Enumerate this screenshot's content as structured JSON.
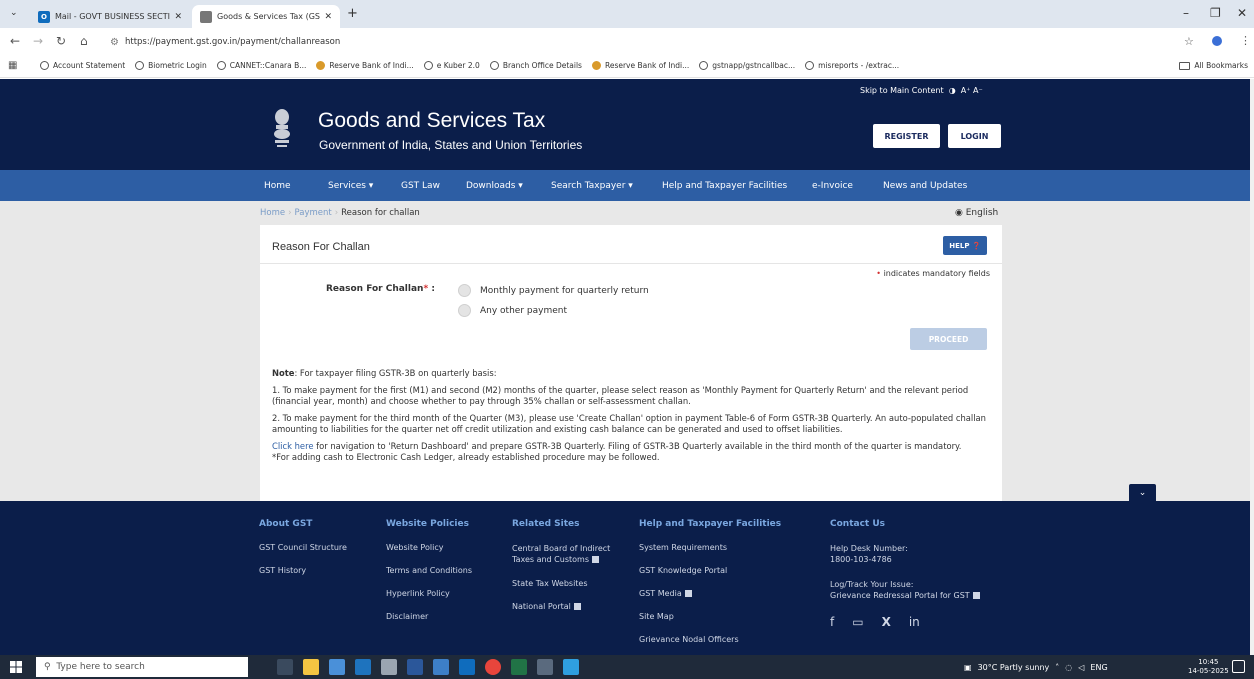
{
  "browser": {
    "tabs": [
      {
        "title": "Mail - GOVT BUSINESS SECTIO",
        "active": false
      },
      {
        "title": "Goods & Services Tax (GST) | Pa",
        "active": true
      }
    ],
    "url": "https://payment.gst.gov.in/payment/challanreason",
    "bookmarks": [
      "Account Statement",
      "Biometric Login",
      "CANNET::Canara B...",
      "Reserve Bank of Indi...",
      "e Kuber 2.0",
      "Branch Office Details",
      "Reserve Bank of Indi...",
      "gstnapp/gstncallbac...",
      "misreports - /extrac..."
    ],
    "all_bookmarks": "All Bookmarks"
  },
  "header": {
    "skip": "Skip to Main Content",
    "font_controls": "A⁺  A⁻",
    "title": "Goods and Services Tax",
    "subtitle": "Government of India, States and Union Territories",
    "register": "REGISTER",
    "login": "LOGIN"
  },
  "nav": {
    "items": [
      "Home",
      "Services ▾",
      "GST Law",
      "Downloads ▾",
      "Search Taxpayer ▾",
      "Help and Taxpayer Facilities",
      "e-Invoice",
      "News and Updates"
    ]
  },
  "breadcrumb": {
    "home": "Home",
    "payment": "Payment",
    "current": "Reason for challan"
  },
  "language": "English",
  "card": {
    "title": "Reason For Challan",
    "help": "HELP",
    "mandatory_note": "indicates mandatory fields",
    "reason_label": "Reason For Challan",
    "options": [
      "Monthly payment for quarterly return",
      "Any other payment"
    ],
    "proceed": "PROCEED"
  },
  "notes": {
    "note_label": "Note",
    "note_text": ": For taxpayer filing GSTR-3B on quarterly basis:",
    "point1": "1. To make payment for the first (M1) and second (M2) months of the quarter, please select reason as 'Monthly Payment for Quarterly Return' and the relevant period (financial year, month) and choose whether to pay through 35% challan or self-assessment challan.",
    "point2": "2. To make payment for the third month of the Quarter (M3), please use 'Create Challan' option in payment Table-6 of Form GSTR-3B Quarterly. An auto-populated challan amounting to liabilities for the quarter net off credit utilization and existing cash balance can be generated and used to offset liabilities.",
    "click_here": "Click here",
    "click_text": " for navigation to 'Return Dashboard' and prepare GSTR-3B Quarterly. Filing of GSTR-3B Quarterly available in the third month of the quarter is mandatory.",
    "cash_note": "*For adding cash to Electronic Cash Ledger, already established procedure may be followed."
  },
  "footer": {
    "about": {
      "heading": "About GST",
      "items": [
        "GST Council Structure",
        "GST History"
      ]
    },
    "policies": {
      "heading": "Website Policies",
      "items": [
        "Website Policy",
        "Terms and Conditions",
        "Hyperlink Policy",
        "Disclaimer"
      ]
    },
    "related": {
      "heading": "Related Sites",
      "items": [
        "Central Board of Indirect Taxes and Customs",
        "State Tax Websites",
        "National Portal"
      ]
    },
    "help": {
      "heading": "Help and Taxpayer Facilities",
      "items": [
        "System Requirements",
        "GST Knowledge Portal",
        "GST Media",
        "Site Map",
        "Grievance Nodal Officers"
      ]
    },
    "contact": {
      "heading": "Contact Us",
      "helpdesk_label": "Help Desk Number:",
      "helpdesk_number": "1800-103-4786",
      "log_label": "Log/Track Your Issue:",
      "grievance": "Grievance Redressal Portal for GST"
    }
  },
  "taskbar": {
    "search_placeholder": "Type here to search",
    "weather": "30°C  Partly sunny",
    "lang": "ENG",
    "time": "10:45",
    "date": "14-05-2025"
  },
  "colors": {
    "header_bg": "#0b1e4a",
    "nav_bg": "#2d5ea4",
    "accent": "#2d5ea4"
  }
}
